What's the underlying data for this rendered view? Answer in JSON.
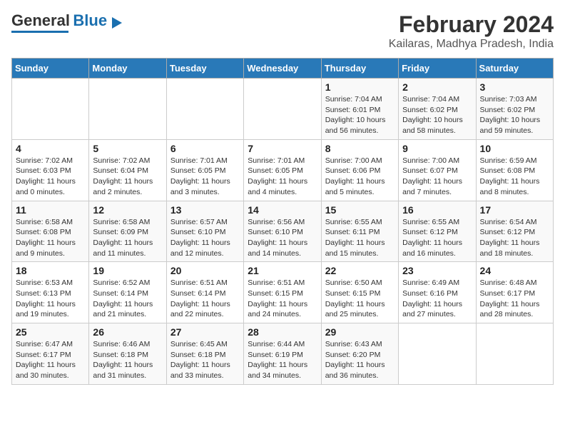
{
  "header": {
    "logo_line1": "General",
    "logo_line2": "Blue",
    "title": "February 2024",
    "subtitle": "Kailaras, Madhya Pradesh, India"
  },
  "weekdays": [
    "Sunday",
    "Monday",
    "Tuesday",
    "Wednesday",
    "Thursday",
    "Friday",
    "Saturday"
  ],
  "weeks": [
    [
      {
        "day": "",
        "info": ""
      },
      {
        "day": "",
        "info": ""
      },
      {
        "day": "",
        "info": ""
      },
      {
        "day": "",
        "info": ""
      },
      {
        "day": "1",
        "info": "Sunrise: 7:04 AM\nSunset: 6:01 PM\nDaylight: 10 hours and 56 minutes."
      },
      {
        "day": "2",
        "info": "Sunrise: 7:04 AM\nSunset: 6:02 PM\nDaylight: 10 hours and 58 minutes."
      },
      {
        "day": "3",
        "info": "Sunrise: 7:03 AM\nSunset: 6:02 PM\nDaylight: 10 hours and 59 minutes."
      }
    ],
    [
      {
        "day": "4",
        "info": "Sunrise: 7:02 AM\nSunset: 6:03 PM\nDaylight: 11 hours and 0 minutes."
      },
      {
        "day": "5",
        "info": "Sunrise: 7:02 AM\nSunset: 6:04 PM\nDaylight: 11 hours and 2 minutes."
      },
      {
        "day": "6",
        "info": "Sunrise: 7:01 AM\nSunset: 6:05 PM\nDaylight: 11 hours and 3 minutes."
      },
      {
        "day": "7",
        "info": "Sunrise: 7:01 AM\nSunset: 6:05 PM\nDaylight: 11 hours and 4 minutes."
      },
      {
        "day": "8",
        "info": "Sunrise: 7:00 AM\nSunset: 6:06 PM\nDaylight: 11 hours and 5 minutes."
      },
      {
        "day": "9",
        "info": "Sunrise: 7:00 AM\nSunset: 6:07 PM\nDaylight: 11 hours and 7 minutes."
      },
      {
        "day": "10",
        "info": "Sunrise: 6:59 AM\nSunset: 6:08 PM\nDaylight: 11 hours and 8 minutes."
      }
    ],
    [
      {
        "day": "11",
        "info": "Sunrise: 6:58 AM\nSunset: 6:08 PM\nDaylight: 11 hours and 9 minutes."
      },
      {
        "day": "12",
        "info": "Sunrise: 6:58 AM\nSunset: 6:09 PM\nDaylight: 11 hours and 11 minutes."
      },
      {
        "day": "13",
        "info": "Sunrise: 6:57 AM\nSunset: 6:10 PM\nDaylight: 11 hours and 12 minutes."
      },
      {
        "day": "14",
        "info": "Sunrise: 6:56 AM\nSunset: 6:10 PM\nDaylight: 11 hours and 14 minutes."
      },
      {
        "day": "15",
        "info": "Sunrise: 6:55 AM\nSunset: 6:11 PM\nDaylight: 11 hours and 15 minutes."
      },
      {
        "day": "16",
        "info": "Sunrise: 6:55 AM\nSunset: 6:12 PM\nDaylight: 11 hours and 16 minutes."
      },
      {
        "day": "17",
        "info": "Sunrise: 6:54 AM\nSunset: 6:12 PM\nDaylight: 11 hours and 18 minutes."
      }
    ],
    [
      {
        "day": "18",
        "info": "Sunrise: 6:53 AM\nSunset: 6:13 PM\nDaylight: 11 hours and 19 minutes."
      },
      {
        "day": "19",
        "info": "Sunrise: 6:52 AM\nSunset: 6:14 PM\nDaylight: 11 hours and 21 minutes."
      },
      {
        "day": "20",
        "info": "Sunrise: 6:51 AM\nSunset: 6:14 PM\nDaylight: 11 hours and 22 minutes."
      },
      {
        "day": "21",
        "info": "Sunrise: 6:51 AM\nSunset: 6:15 PM\nDaylight: 11 hours and 24 minutes."
      },
      {
        "day": "22",
        "info": "Sunrise: 6:50 AM\nSunset: 6:15 PM\nDaylight: 11 hours and 25 minutes."
      },
      {
        "day": "23",
        "info": "Sunrise: 6:49 AM\nSunset: 6:16 PM\nDaylight: 11 hours and 27 minutes."
      },
      {
        "day": "24",
        "info": "Sunrise: 6:48 AM\nSunset: 6:17 PM\nDaylight: 11 hours and 28 minutes."
      }
    ],
    [
      {
        "day": "25",
        "info": "Sunrise: 6:47 AM\nSunset: 6:17 PM\nDaylight: 11 hours and 30 minutes."
      },
      {
        "day": "26",
        "info": "Sunrise: 6:46 AM\nSunset: 6:18 PM\nDaylight: 11 hours and 31 minutes."
      },
      {
        "day": "27",
        "info": "Sunrise: 6:45 AM\nSunset: 6:18 PM\nDaylight: 11 hours and 33 minutes."
      },
      {
        "day": "28",
        "info": "Sunrise: 6:44 AM\nSunset: 6:19 PM\nDaylight: 11 hours and 34 minutes."
      },
      {
        "day": "29",
        "info": "Sunrise: 6:43 AM\nSunset: 6:20 PM\nDaylight: 11 hours and 36 minutes."
      },
      {
        "day": "",
        "info": ""
      },
      {
        "day": "",
        "info": ""
      }
    ]
  ]
}
